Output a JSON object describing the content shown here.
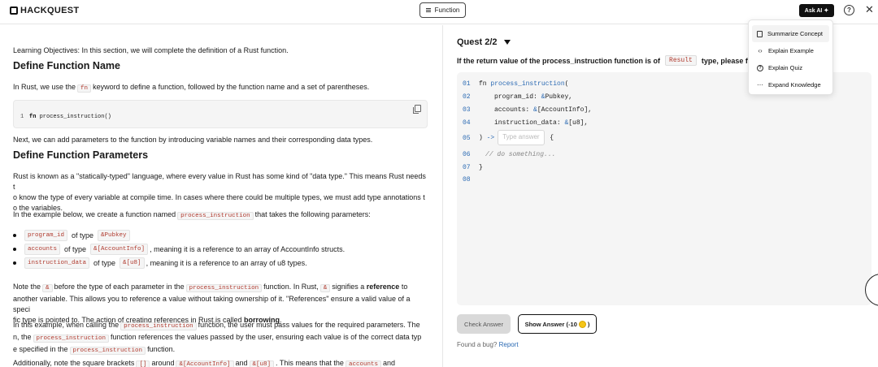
{
  "header": {
    "logo_text": "HACKQUEST",
    "function_button": "Function",
    "ask_ai_label": "Ask AI"
  },
  "ask_ai_menu": {
    "items": [
      "Summarize Concept",
      "Explain Example",
      "Explain Quiz",
      "Expand Knowledge"
    ]
  },
  "lesson": {
    "objectives": "Learning Objectives: In this section, we will complete the definition of a Rust function.",
    "h_define_name": "Define Function Name",
    "p1_a": "In Rust, we use the",
    "p1_code": "fn",
    "p1_b": "keyword to define a function, followed by the function name and a set of parentheses.",
    "code_line_no": "1",
    "code_kw": "fn",
    "code_name": "process_instruction",
    "code_parens": "()",
    "p2": "Next, we can add parameters to the function by introducing variable names and their corresponding data types.",
    "h_define_params": "Define Function Parameters",
    "p3_line1": "Rust is known as a \"statically-typed\" language, where every value in Rust has some kind of \"data type.\" This means Rust needs t",
    "p3_line2": "o know the type of every variable at compile time. In cases where there could be multiple types, we must add type annotations t",
    "p3_line3": "o the variables.",
    "p4_a": "In the example below, we create a function named",
    "p4_code": "process_instruction",
    "p4_b": "that takes the following parameters:",
    "bullets": [
      {
        "name": "program_id",
        "of": "of type",
        "type": "&Pubkey",
        "rest": ""
      },
      {
        "name": "accounts",
        "of": "of type",
        "type": "&[AccountInfo]",
        "rest": ", meaning it is a reference to an array of AccountInfo structs."
      },
      {
        "name": "instruction_data",
        "of": "of type",
        "type": "&[u8]",
        "rest": ", meaning it is a reference to an array of u8 types."
      }
    ],
    "p5_a": "Note the",
    "p5_code1": "&",
    "p5_b": "before the type of each parameter in the",
    "p5_code2": "process_instruction",
    "p5_c": "function. In Rust,",
    "p5_code3": "&",
    "p5_d": "signifies a",
    "p5_bold1": "reference",
    "p5_e": "to",
    "p5_line2": "another variable. This allows you to reference a value without taking ownership of it. \"References\" ensure a valid value of a speci",
    "p5_line3_a": "fic type is pointed to. The action of creating references in Rust is called",
    "p5_bold2": "borrowing",
    "p5_line3_b": ".",
    "p6_a": "In this example, when calling the",
    "p6_code1": "process_instruction",
    "p6_b": "function, the user must pass values for the required parameters. The",
    "p6_c": "n, the",
    "p6_code2": "process_instruction",
    "p6_d": "function references the values passed by the user, ensuring each value is of the correct data typ",
    "p6_e": "e specified in the",
    "p6_code3": "process_instruction",
    "p6_f": "function.",
    "p7_a": "Additionally, note the square brackets",
    "p7_code1": "[]",
    "p7_b": "around",
    "p7_code2": "&[AccountInfo]",
    "p7_c": "and",
    "p7_code3": "&[u8]",
    "p7_d": ". This means that the",
    "p7_code4": "accounts",
    "p7_e": "and"
  },
  "quiz": {
    "title": "Quest 2/2",
    "question_a": "If the return value of the process_instruction function is of",
    "question_code": "Result",
    "question_b": "type, please fill in",
    "code": {
      "l01_no": "01",
      "l01_kw": "fn",
      "l01_name": "process_instruction",
      "l01_paren": "(",
      "l02_no": "02",
      "l02_name": "program_id:",
      "l02_amp": "&",
      "l02_type": "Pubkey,",
      "l03_no": "03",
      "l03_name": "accounts:",
      "l03_amp": "&",
      "l03_type": "[AccountInfo],",
      "l04_no": "04",
      "l04_name": "instruction_data:",
      "l04_amp": "&",
      "l04_type": "[u8],",
      "l05_no": "05",
      "l05_close": ")",
      "l05_arrow": "->",
      "l05_brace": "{",
      "l06_no": "06",
      "l06_comment": "// do something...",
      "l07_no": "07",
      "l07_close": "}",
      "l08_no": "08"
    },
    "answer_placeholder": "Type answer",
    "check_answer": "Check Answer",
    "show_answer": "Show Answer (-10",
    "show_answer_end": ")",
    "bug_text": "Found a bug?",
    "bug_link": "Report"
  }
}
